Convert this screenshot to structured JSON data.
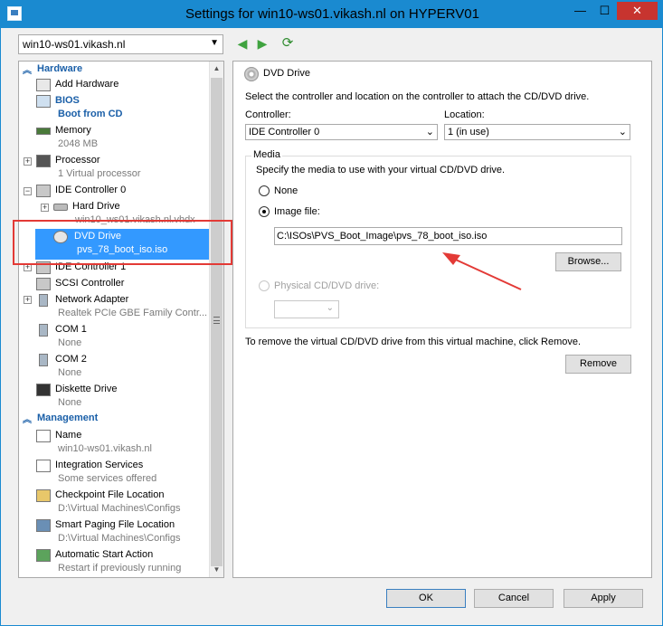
{
  "window": {
    "title": "Settings for win10-ws01.vikash.nl on HYPERV01",
    "minimize": "—",
    "maximize": "☐",
    "close": "✕"
  },
  "toolbar": {
    "vm_select_value": "win10-ws01.vikash.nl",
    "back_icon": "◀",
    "forward_icon": "▶",
    "refresh_icon": "⟳"
  },
  "tree": {
    "hardware_header": "Hardware",
    "add_hardware": "Add Hardware",
    "bios": "BIOS",
    "bios_sub": "Boot from CD",
    "memory": "Memory",
    "memory_sub": "2048 MB",
    "processor": "Processor",
    "processor_sub": "1 Virtual processor",
    "ide0": "IDE Controller 0",
    "hard_drive": "Hard Drive",
    "hard_drive_sub": "win10_ws01.vikash.nl.vhdx",
    "dvd_drive": "DVD Drive",
    "dvd_drive_sub": "pvs_78_boot_iso.iso",
    "ide1": "IDE Controller 1",
    "scsi": "SCSI Controller",
    "network": "Network Adapter",
    "network_sub": "Realtek PCIe GBE Family Contr...",
    "com1": "COM 1",
    "com1_sub": "None",
    "com2": "COM 2",
    "com2_sub": "None",
    "diskette": "Diskette Drive",
    "diskette_sub": "None",
    "management_header": "Management",
    "name": "Name",
    "name_sub": "win10-ws01.vikash.nl",
    "integration": "Integration Services",
    "integration_sub": "Some services offered",
    "checkpoint": "Checkpoint File Location",
    "checkpoint_sub": "D:\\Virtual Machines\\Configs",
    "paging": "Smart Paging File Location",
    "paging_sub": "D:\\Virtual Machines\\Configs",
    "autostart": "Automatic Start Action",
    "autostart_sub": "Restart if previously running"
  },
  "dvd": {
    "title": "DVD Drive",
    "description": "Select the controller and location on the controller to attach the CD/DVD drive.",
    "controller_label": "Controller:",
    "controller_value": "IDE Controller 0",
    "location_label": "Location:",
    "location_value": "1 (in use)",
    "media_label": "Media",
    "media_description": "Specify the media to use with your virtual CD/DVD drive.",
    "none_label": "None",
    "image_label": "Image file:",
    "image_path": "C:\\ISOs\\PVS_Boot_Image\\pvs_78_boot_iso.iso",
    "browse_label": "Browse...",
    "physical_label": "Physical CD/DVD drive:",
    "remove_description": "To remove the virtual CD/DVD drive from this virtual machine, click Remove.",
    "remove_label": "Remove"
  },
  "footer": {
    "ok": "OK",
    "cancel": "Cancel",
    "apply": "Apply"
  },
  "colors": {
    "titlebar": "#1a8ad0",
    "selection": "#3399ff",
    "annotation_red": "#e33a36",
    "section_blue": "#1a5fa8"
  }
}
